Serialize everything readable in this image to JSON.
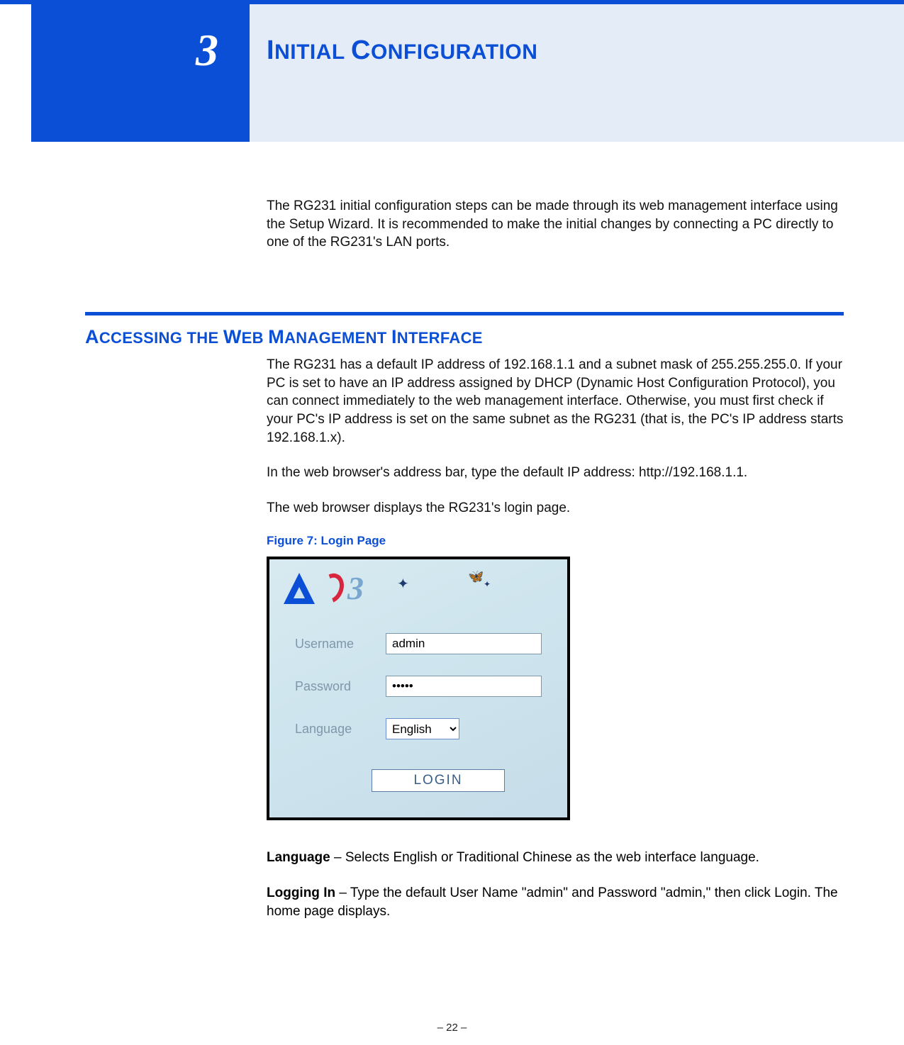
{
  "chapter": {
    "number": "3"
  },
  "title": {
    "caps1": "I",
    "rest1": "NITIAL",
    "caps2": "C",
    "rest2": "ONFIGURATION"
  },
  "intro": "The RG231 initial configuration steps can be made through its web management interface using the Setup Wizard. It is recommended to make the initial changes by connecting a PC directly to one of the RG231's LAN ports.",
  "section": {
    "A": "A",
    "r1": "CCESSING",
    "T": "THE",
    "W": "W",
    "r2": "EB",
    "M": "M",
    "r3": "ANAGEMENT",
    "I": "I",
    "r4": "NTERFACE"
  },
  "body": {
    "p1": "The RG231 has a default IP address of 192.168.1.1 and a subnet mask of 255.255.255.0. If your PC is set to have an IP address assigned by DHCP (Dynamic Host Configuration Protocol), you can connect immediately to the web management interface. Otherwise, you must first check if your PC's IP address is set on the same subnet as the RG231 (that is, the PC's IP address starts 192.168.1.x).",
    "p2": "In the web browser's address bar, type the default IP address: http://192.168.1.1.",
    "p3": "The web browser displays the RG231's login page."
  },
  "figure": {
    "caption": "Figure 7:  Login Page"
  },
  "login": {
    "username_label": "Username",
    "username_value": "admin",
    "password_label": "Password",
    "password_value": "•••••",
    "language_label": "Language",
    "language_value": "English",
    "button": "LOGIN",
    "logo_three": "3"
  },
  "desc": {
    "lang_b": "Language",
    "lang_t": " – Selects English or Traditional Chinese as the web interface language.",
    "login_b": "Logging In",
    "login_t": " – Type the default User Name \"admin\" and Password \"admin,\" then click Login. The home page displays."
  },
  "footer": "–  22  –"
}
